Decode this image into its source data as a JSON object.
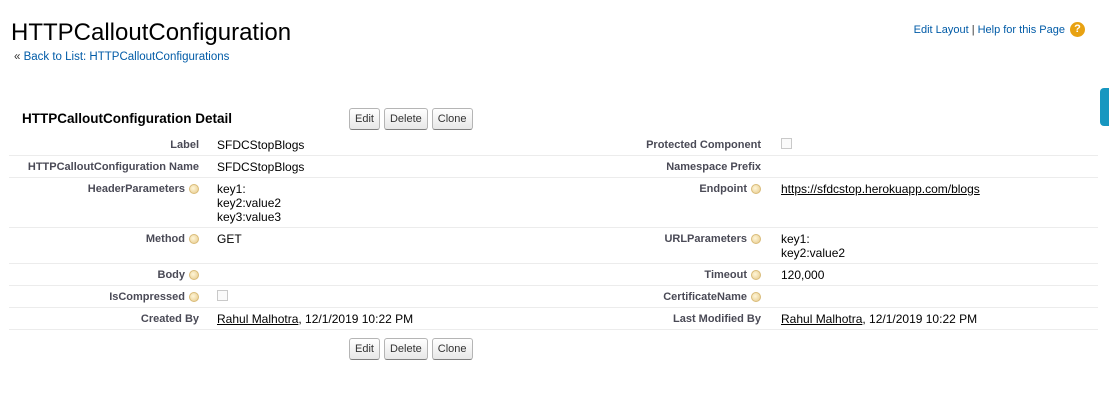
{
  "header": {
    "title": "HTTPCalloutConfiguration",
    "back_prefix": "« ",
    "back_link": "Back to List: HTTPCalloutConfigurations",
    "edit_layout": "Edit Layout",
    "separator": "|",
    "help": "Help for this Page",
    "help_icon": "?"
  },
  "section": {
    "title": "HTTPCalloutConfiguration Detail",
    "buttons": {
      "edit": "Edit",
      "delete": "Delete",
      "clone": "Clone"
    }
  },
  "fields": {
    "label": {
      "label": "Label",
      "value": "SFDCStopBlogs"
    },
    "protected_component": {
      "label": "Protected Component",
      "checked": false
    },
    "name": {
      "label": "HTTPCalloutConfiguration Name",
      "value": "SFDCStopBlogs"
    },
    "namespace_prefix": {
      "label": "Namespace Prefix",
      "value": ""
    },
    "header_parameters": {
      "label": "HeaderParameters",
      "value": "key1:\nkey2:value2\nkey3:value3"
    },
    "endpoint": {
      "label": "Endpoint",
      "value": "https://sfdcstop.herokuapp.com/blogs"
    },
    "method": {
      "label": "Method",
      "value": "GET"
    },
    "url_parameters": {
      "label": "URLParameters",
      "value": "key1:\nkey2:value2"
    },
    "body": {
      "label": "Body",
      "value": ""
    },
    "timeout": {
      "label": "Timeout",
      "value": "120,000"
    },
    "is_compressed": {
      "label": "IsCompressed",
      "checked": false
    },
    "certificate_name": {
      "label": "CertificateName",
      "value": ""
    },
    "created_by": {
      "label": "Created By",
      "user": "Rahul Malhotra",
      "date": ", 12/1/2019 10:22 PM"
    },
    "last_modified_by": {
      "label": "Last Modified By",
      "user": "Rahul Malhotra",
      "date": ", 12/1/2019 10:22 PM"
    }
  },
  "colors": {
    "link": "#015ba7",
    "label": "#4a4a56",
    "help": "#e8a212",
    "side_tab": "#1797c0"
  }
}
